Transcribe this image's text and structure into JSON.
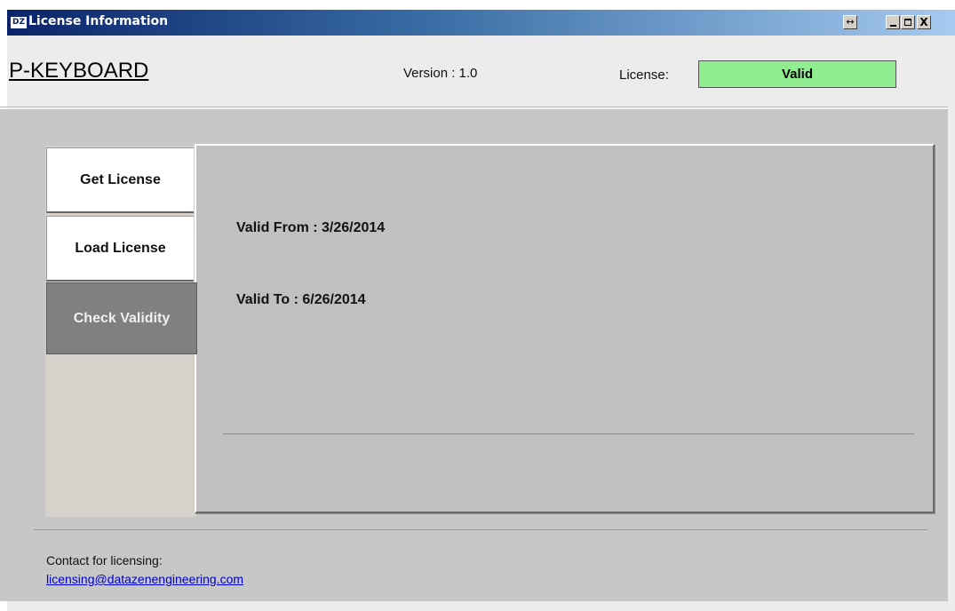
{
  "window": {
    "title": "License Information",
    "icon_text": "DZ",
    "controls": {
      "resize": "↔",
      "close": "X"
    }
  },
  "header": {
    "app_name": "P-KEYBOARD",
    "version": "Version : 1.0",
    "license_label": "License:",
    "license_status": "Valid",
    "license_status_color": "#90ee90"
  },
  "tabs": [
    {
      "label": "Get License"
    },
    {
      "label": "Load License"
    },
    {
      "label": "Check Validity",
      "active": true
    }
  ],
  "validity": {
    "from": "Valid From :  3/26/2014",
    "to": "Valid To :  6/26/2014"
  },
  "footer": {
    "contact_label": "Contact for licensing:",
    "contact_email": "licensing@datazenengineering.com"
  }
}
